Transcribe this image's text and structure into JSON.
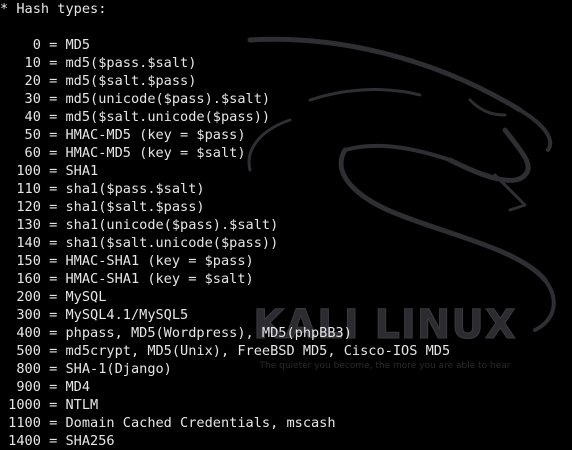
{
  "wallpaper": {
    "logo_text": "KALI LINUX",
    "tagline": "The quieter you become, the more you are able to hear",
    "dragon": "kali-dragon-logo"
  },
  "terminal": {
    "lines": [
      "* Hash types:",
      "",
      "    0 = MD5",
      "   10 = md5($pass.$salt)",
      "   20 = md5($salt.$pass)",
      "   30 = md5(unicode($pass).$salt)",
      "   40 = md5($salt.unicode($pass))",
      "   50 = HMAC-MD5 (key = $pass)",
      "   60 = HMAC-MD5 (key = $salt)",
      "  100 = SHA1",
      "  110 = sha1($pass.$salt)",
      "  120 = sha1($salt.$pass)",
      "  130 = sha1(unicode($pass).$salt)",
      "  140 = sha1($salt.unicode($pass))",
      "  150 = HMAC-SHA1 (key = $pass)",
      "  160 = HMAC-SHA1 (key = $salt)",
      "  200 = MySQL",
      "  300 = MySQL4.1/MySQL5",
      "  400 = phpass, MD5(Wordpress), MD5(phpBB3)",
      "  500 = md5crypt, MD5(Unix), FreeBSD MD5, Cisco-IOS MD5",
      "  800 = SHA-1(Django)",
      "  900 = MD4",
      " 1000 = NTLM",
      " 1100 = Domain Cached Credentials, mscash",
      " 1400 = SHA256"
    ]
  }
}
